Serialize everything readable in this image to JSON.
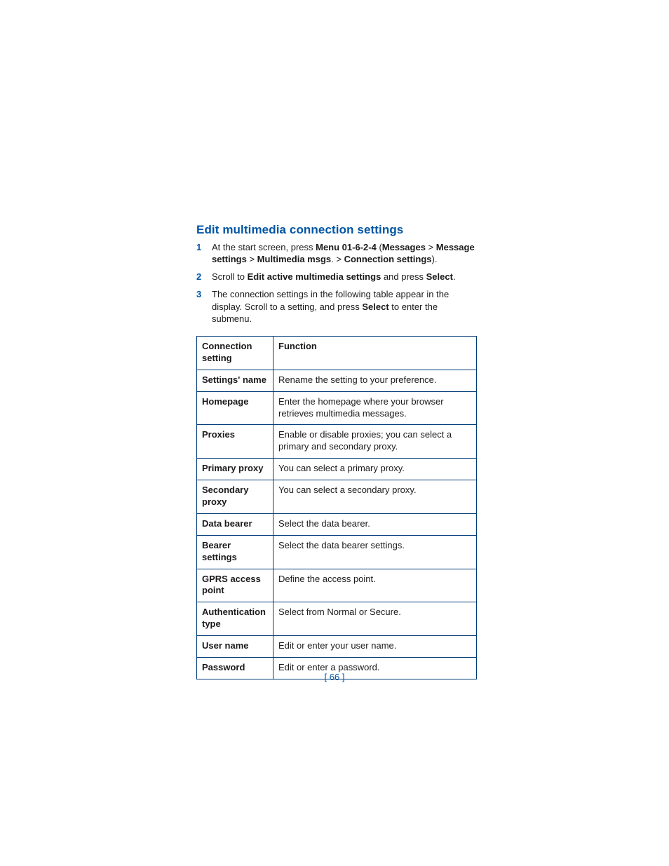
{
  "heading": "Edit multimedia connection settings",
  "steps": [
    {
      "num": "1",
      "segments": [
        {
          "t": "At the start screen, press "
        },
        {
          "t": "Menu 01-6-2-4",
          "b": true
        },
        {
          "t": " ("
        },
        {
          "t": "Messages",
          "b": true
        },
        {
          "t": " > "
        },
        {
          "t": "Message settings",
          "b": true
        },
        {
          "t": " > "
        },
        {
          "t": "Multimedia msgs",
          "b": true
        },
        {
          "t": ". > "
        },
        {
          "t": "Connection settings",
          "b": true
        },
        {
          "t": ")."
        }
      ]
    },
    {
      "num": "2",
      "segments": [
        {
          "t": "Scroll to "
        },
        {
          "t": "Edit active multimedia settings",
          "b": true
        },
        {
          "t": " and press "
        },
        {
          "t": "Select",
          "b": true
        },
        {
          "t": "."
        }
      ]
    },
    {
      "num": "3",
      "segments": [
        {
          "t": "The connection settings in the following table appear in the display. Scroll to a setting, and press "
        },
        {
          "t": "Select",
          "b": true
        },
        {
          "t": " to enter the submenu."
        }
      ]
    }
  ],
  "table": {
    "headers": [
      "Connection setting",
      "Function"
    ],
    "rows": [
      {
        "key": "Settings' name",
        "val": "Rename the setting to your preference."
      },
      {
        "key": "Homepage",
        "val": "Enter the homepage where your browser retrieves multimedia messages."
      },
      {
        "key": "Proxies",
        "val": "Enable or disable proxies; you can select a primary and secondary proxy."
      },
      {
        "key": "Primary proxy",
        "val": "You can select a primary proxy."
      },
      {
        "key": "Secondary proxy",
        "val": "You can select a secondary proxy."
      },
      {
        "key": "Data bearer",
        "val": "Select the data bearer."
      },
      {
        "key": "Bearer settings",
        "val": "Select the data bearer settings."
      },
      {
        "key": "GPRS access point",
        "val": "Define the access point."
      },
      {
        "key": "Authentication type",
        "val": "Select from Normal or Secure."
      },
      {
        "key": "User name",
        "val": "Edit or enter your user name."
      },
      {
        "key": "Password",
        "val": "Edit or enter a password."
      }
    ]
  },
  "page_number": "[ 66 ]"
}
